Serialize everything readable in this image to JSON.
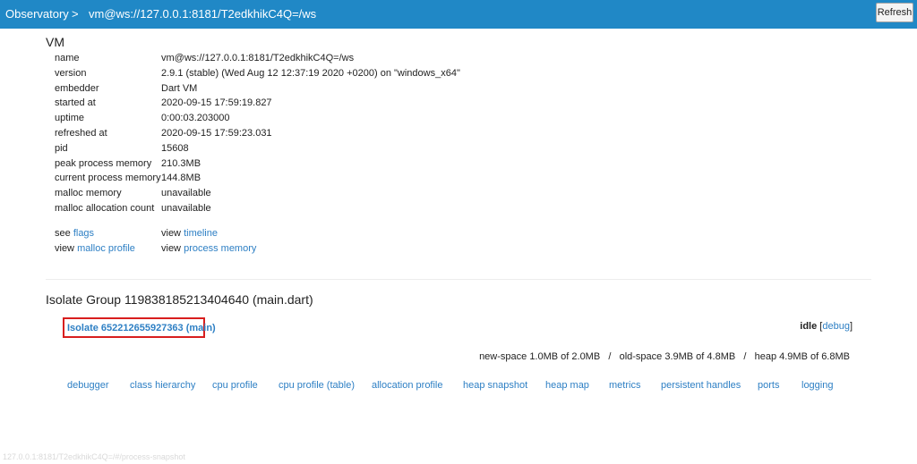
{
  "nav": {
    "app_title": "Observatory",
    "separator": ">",
    "vm_crumb": "vm@ws://127.0.0.1:8181/T2edkhikC4Q=/ws",
    "refresh_label": "Refresh"
  },
  "vm": {
    "title": "VM",
    "properties": [
      {
        "key": "name",
        "value": "vm@ws://127.0.0.1:8181/T2edkhikC4Q=/ws"
      },
      {
        "key": "version",
        "value": "2.9.1 (stable) (Wed Aug 12 12:37:19 2020 +0200) on \"windows_x64\""
      },
      {
        "key": "embedder",
        "value": "Dart VM"
      },
      {
        "key": "started at",
        "value": "2020-09-15 17:59:19.827"
      },
      {
        "key": "uptime",
        "value": "0:00:03.203000"
      },
      {
        "key": "refreshed at",
        "value": "2020-09-15 17:59:23.031"
      },
      {
        "key": "pid",
        "value": "15608"
      },
      {
        "key": "peak process memory",
        "value": "210.3MB"
      },
      {
        "key": "current process memory",
        "value": "144.8MB"
      },
      {
        "key": "malloc memory",
        "value": "unavailable"
      },
      {
        "key": "malloc allocation count",
        "value": "unavailable"
      }
    ],
    "links": {
      "see_prefix": "see",
      "flags": "flags",
      "view_prefix": "view",
      "timeline": "timeline",
      "malloc_profile": "malloc profile",
      "process_memory": "process memory"
    }
  },
  "isolate_group": {
    "title": "Isolate Group 119838185213404640 (main.dart)",
    "isolate_link": "Isolate 652212655927363 (main)",
    "state": "idle",
    "debug_open": "[",
    "debug_label": "debug",
    "debug_close": "]",
    "memory": "new-space 1.0MB of 2.0MB   /   old-space 3.9MB of 4.8MB   /   heap 4.9MB of 6.8MB",
    "tools": [
      "debugger",
      "class hierarchy",
      "cpu profile",
      "cpu profile (table)",
      "allocation profile",
      "heap snapshot",
      "heap map",
      "metrics",
      "persistent handles",
      "ports",
      "logging"
    ]
  },
  "status_url": "127.0.0.1:8181/T2edkhikC4Q=/#/process-snapshot"
}
